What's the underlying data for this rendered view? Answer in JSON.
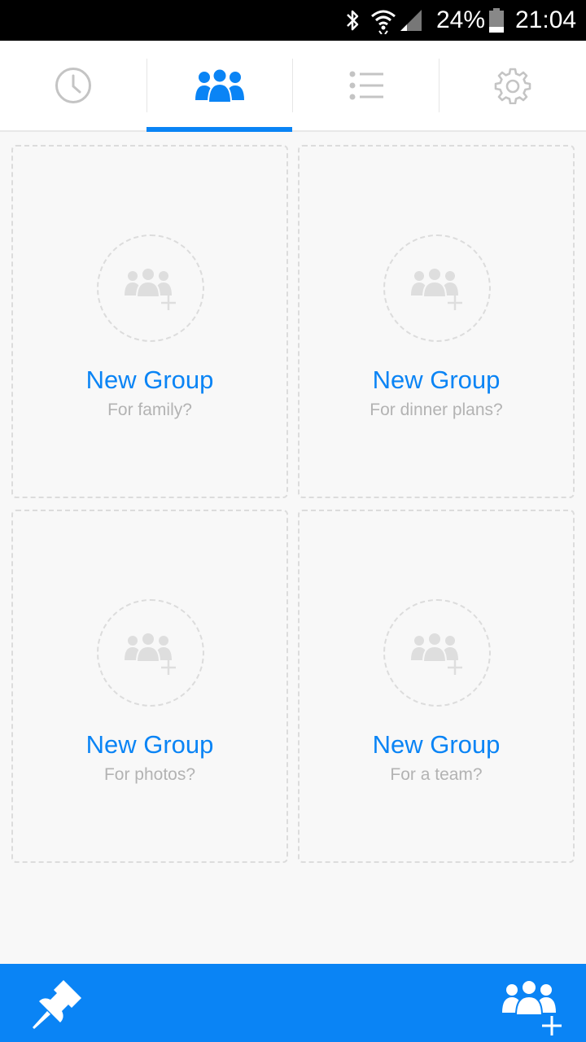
{
  "status_bar": {
    "battery": "24%",
    "time": "21:04",
    "icons": [
      "bluetooth-icon",
      "wifi-icon",
      "signal-icon",
      "battery-icon"
    ]
  },
  "tabs": [
    {
      "icon": "clock-icon",
      "active": false
    },
    {
      "icon": "groups-icon",
      "active": true
    },
    {
      "icon": "list-icon",
      "active": false
    },
    {
      "icon": "gear-icon",
      "active": false
    }
  ],
  "cards": [
    {
      "title": "New Group",
      "subtitle": "For family?"
    },
    {
      "title": "New Group",
      "subtitle": "For dinner plans?"
    },
    {
      "title": "New Group",
      "subtitle": "For photos?"
    },
    {
      "title": "New Group",
      "subtitle": "For a team?"
    }
  ],
  "bottom_bar": {
    "left_icon": "pin-icon",
    "right_icon": "add-group-icon"
  },
  "colors": {
    "accent": "#0a84f5",
    "muted_text": "#b3b3b3",
    "placeholder_icon": "#dedede",
    "background": "#f8f8f8"
  }
}
